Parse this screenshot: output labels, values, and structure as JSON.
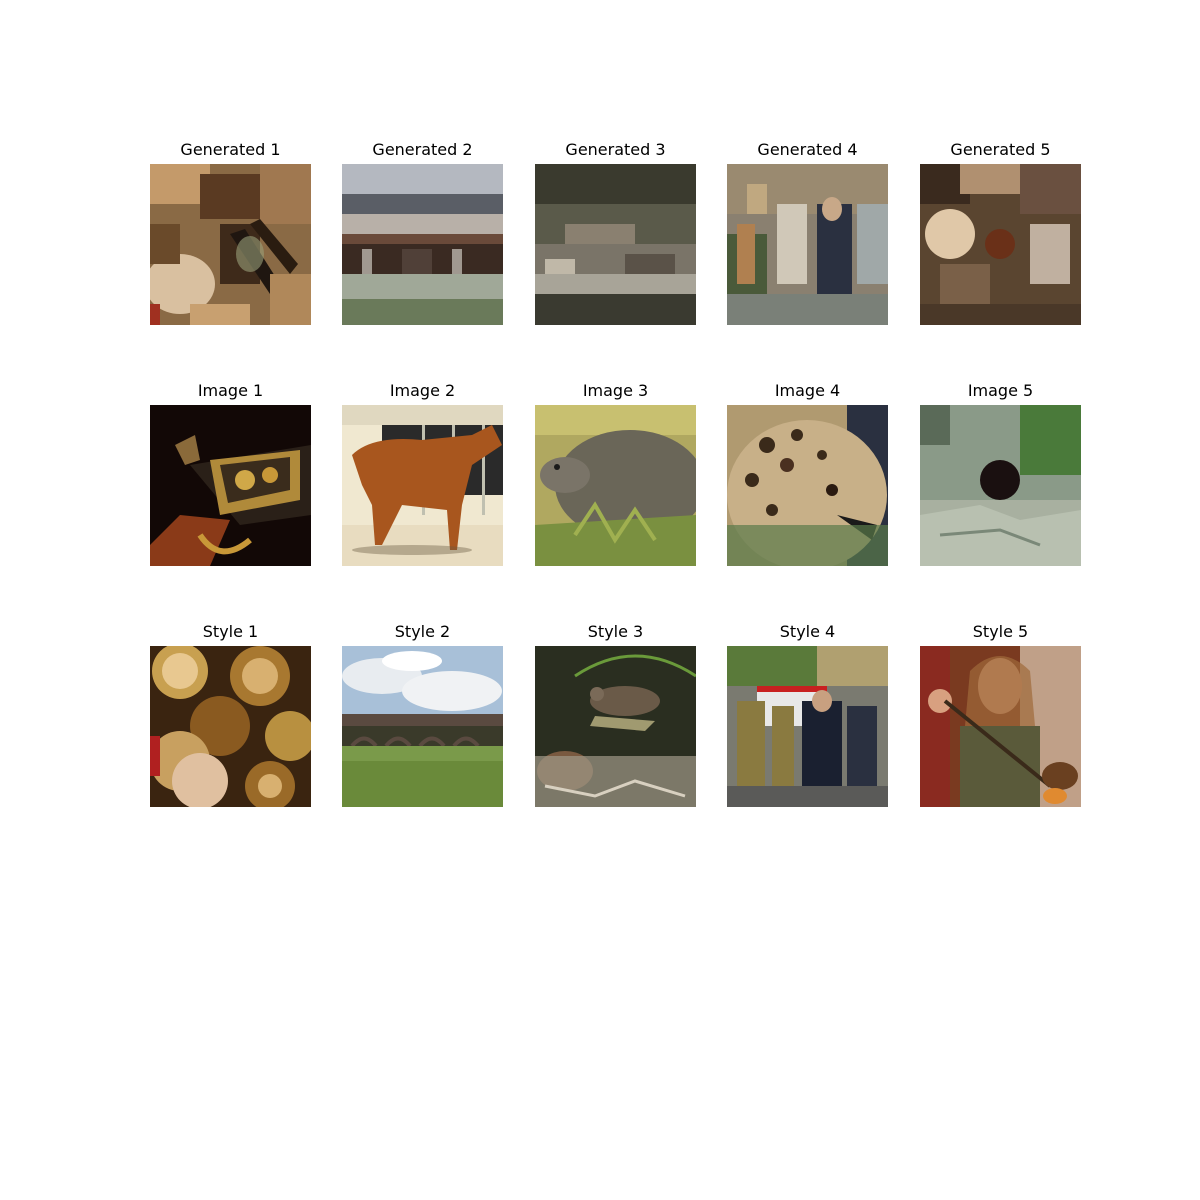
{
  "figure": {
    "rows": [
      {
        "row": "generated",
        "panels": [
          {
            "title": "Generated 1",
            "content": "blurry-patchwork-warm"
          },
          {
            "title": "Generated 2",
            "content": "blurry-building-sky"
          },
          {
            "title": "Generated 3",
            "content": "blurry-dark-landscape"
          },
          {
            "title": "Generated 4",
            "content": "blurry-people-scene"
          },
          {
            "title": "Generated 5",
            "content": "blurry-warm-figures"
          }
        ]
      },
      {
        "row": "image",
        "panels": [
          {
            "title": "Image 1",
            "content": "revolver"
          },
          {
            "title": "Image 2",
            "content": "horse"
          },
          {
            "title": "Image 3",
            "content": "wombat"
          },
          {
            "title": "Image 4",
            "content": "leopard"
          },
          {
            "title": "Image 5",
            "content": "black-animal-on-rocks"
          }
        ]
      },
      {
        "row": "style",
        "panels": [
          {
            "title": "Style 1",
            "content": "bottle-caps"
          },
          {
            "title": "Style 2",
            "content": "viaduct-field-sky"
          },
          {
            "title": "Style 3",
            "content": "birds-on-ground"
          },
          {
            "title": "Style 4",
            "content": "firefighters-ambulance"
          },
          {
            "title": "Style 5",
            "content": "man-glassblowing"
          }
        ]
      }
    ]
  }
}
